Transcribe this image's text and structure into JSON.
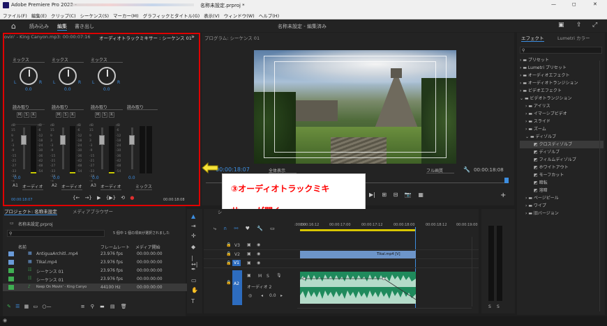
{
  "app": {
    "title": "Adobe Premiere Pro 2022 - ",
    "project_path": "名称未設定.prproj *",
    "window_controls": [
      "—",
      "◻",
      "✕"
    ]
  },
  "menu": [
    "ファイル(F)",
    "編集(E)",
    "クリップ(C)",
    "シーケンス(S)",
    "マーカー(M)",
    "グラフィックとタイトル(G)",
    "表示(V)",
    "ウィンドウ(W)",
    "ヘルプ(H)"
  ],
  "workspace": {
    "tabs": [
      "読み込み",
      "編集",
      "書き出し"
    ],
    "active_tab": "編集",
    "center_title": "名称未設定 - 編集済み"
  },
  "mixer": {
    "tab_source": "ovin' - King Canyon.mp3: 00:00:07:16",
    "tab_active": "オーディオトラックミキサー : シーケンス 01",
    "more": "»",
    "channels": [
      {
        "mode": "ミックス",
        "auto": "読み取り",
        "value": "0.0",
        "vol": "0.0",
        "label": "A1",
        "name": "オーディオ"
      },
      {
        "mode": "ミックス",
        "auto": "読み取り",
        "value": "0.0",
        "vol": "0.0",
        "label": "A2",
        "name": "オーディオ"
      },
      {
        "mode": "ミックス",
        "auto": "読み取り",
        "value": "0.0",
        "vol": "0.0",
        "label": "A3",
        "name": "オーディオ"
      }
    ],
    "master": {
      "auto": "読み取り",
      "vol": "0.0",
      "name": "ミックス"
    },
    "scale": [
      "dB",
      "15",
      "9",
      "3",
      "-3",
      "-9",
      "-15",
      "-21",
      "-27",
      "-33",
      "-39",
      "-∞"
    ],
    "scale_right": [
      "dB",
      "-6",
      "-12",
      "-18",
      "-24",
      "-30",
      "-36",
      "-42",
      "-48",
      "-54"
    ],
    "lr": [
      "L",
      "R"
    ],
    "msr": [
      "M",
      "S",
      "R"
    ],
    "time_left": "00:00:18:07",
    "time_right": "00:00:18:08"
  },
  "program": {
    "title": "プログラム: シーケンス 01",
    "timecode": "00:00:18:07",
    "fit": "全体表示",
    "quality": "フル画質",
    "duration": "00:00:18:08"
  },
  "callout": {
    "line1": "③オーディオトラックミキ",
    "line2": "サー」が開く"
  },
  "project": {
    "tab": "プロジェクト: 名称未設定",
    "tab2": "メディアブラウザー",
    "file": "名称未設定.prproj",
    "selection": "5 個中 1 個の項目が選択されました",
    "headers": [
      "名前",
      "フレームレート",
      "メディア開始"
    ],
    "items": [
      {
        "name": "AntiguaArchitl..mp4",
        "fps": "23.976 fps",
        "start": "00:00:00:00",
        "color": "#6a9bd8"
      },
      {
        "name": "TIkal.mp4",
        "fps": "23.976 fps",
        "start": "00:00:00:00",
        "color": "#6a9bd8"
      },
      {
        "name": "シーケンス 01",
        "fps": "23.976 fps",
        "start": "00:00:00:00",
        "color": "#3fae52"
      },
      {
        "name": "シーケンス 01",
        "fps": "23.976 fps",
        "start": "00:00:00:00",
        "color": "#3fae52"
      },
      {
        "name": "Keep On Movin' - King Canyo",
        "fps": "44100 Hz",
        "start": "00:00:00:00",
        "color": "#3fae52"
      }
    ]
  },
  "timeline": {
    "ruler": [
      ":00:00",
      "0:00:16:12",
      "00:00:17:00",
      "00:00:17:12",
      "00:00:18:00",
      "00:00:18:12",
      "00:00:19:00"
    ],
    "tracks": [
      "V3",
      "V2",
      "V1",
      "A2"
    ],
    "clip_label": "TIkal.mp4 [V]",
    "audio_track_name": "オーディオ 2",
    "audio_value": "0.0",
    "timecode_fragment": "シ"
  },
  "effects": {
    "tab": "エフェクト",
    "tab2": "Lumetri カラー",
    "items": [
      {
        "label": "プリセット",
        "level": 0
      },
      {
        "label": "Lumetri プリセット",
        "level": 0
      },
      {
        "label": "オーディオエフェクト",
        "level": 0
      },
      {
        "label": "オーディオトランジション",
        "level": 0
      },
      {
        "label": "ビデオエフェクト",
        "level": 0
      },
      {
        "label": "ビデオトランジション",
        "level": 0
      },
      {
        "label": "アイリス",
        "level": 1
      },
      {
        "label": "イマーシブビデオ",
        "level": 1
      },
      {
        "label": "スライド",
        "level": 1
      },
      {
        "label": "ズーム",
        "level": 1
      },
      {
        "label": "ディゾルブ",
        "level": 1
      },
      {
        "label": "クロスディゾルブ",
        "level": 2,
        "selected": true
      },
      {
        "label": "ディゾルブ",
        "level": 2
      },
      {
        "label": "フィルムディゾルブ",
        "level": 2
      },
      {
        "label": "ホワイトアウト",
        "level": 2
      },
      {
        "label": "モーフカット",
        "level": 2
      },
      {
        "label": "暗転",
        "level": 2
      },
      {
        "label": "溶暗",
        "level": 2
      },
      {
        "label": "ページピール",
        "level": 1
      },
      {
        "label": "ワイプ",
        "level": 1
      },
      {
        "label": "旧バージョン",
        "level": 1
      }
    ]
  },
  "meter_ss": [
    "S",
    "S"
  ]
}
